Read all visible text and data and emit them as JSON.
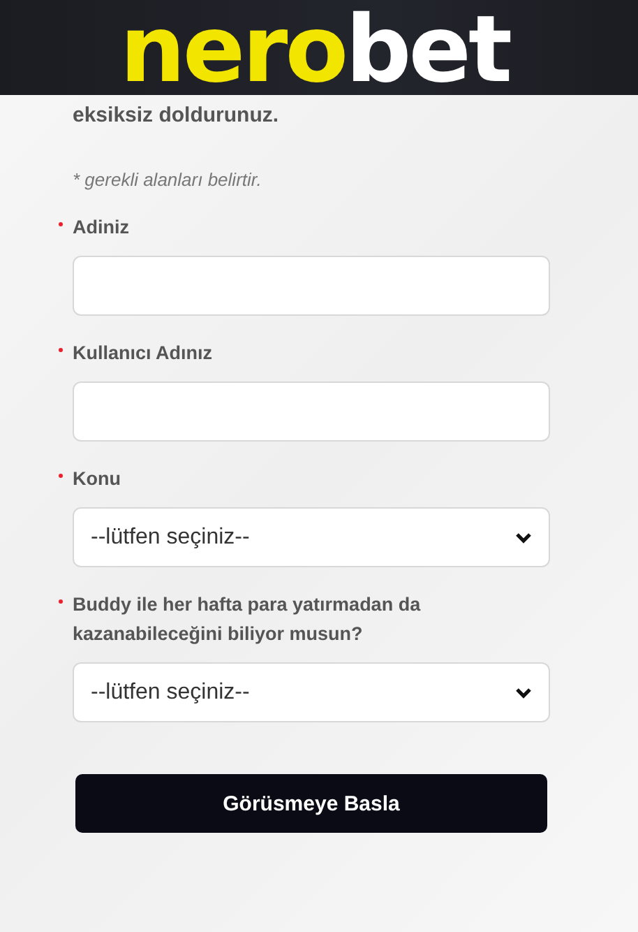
{
  "header": {
    "logo": {
      "accent": "nero",
      "rest": "bet"
    }
  },
  "intro": "eksiksiz doldurunuz.",
  "note": "* gerekli alanları belirtir.",
  "fields": [
    {
      "kind": "text",
      "label": "Adiniz",
      "required": true
    },
    {
      "kind": "text",
      "label": "Kullanıcı Adınız",
      "required": true
    },
    {
      "kind": "select",
      "label": "Konu",
      "required": true,
      "value": "--lütfen seçiniz--"
    },
    {
      "kind": "select",
      "label": "Buddy ile her hafta para yatırmadan da kazanabileceğini biliyor musun?",
      "required": true,
      "value": "--lütfen seçiniz--"
    }
  ],
  "submit": "Görüsmeye Basla"
}
